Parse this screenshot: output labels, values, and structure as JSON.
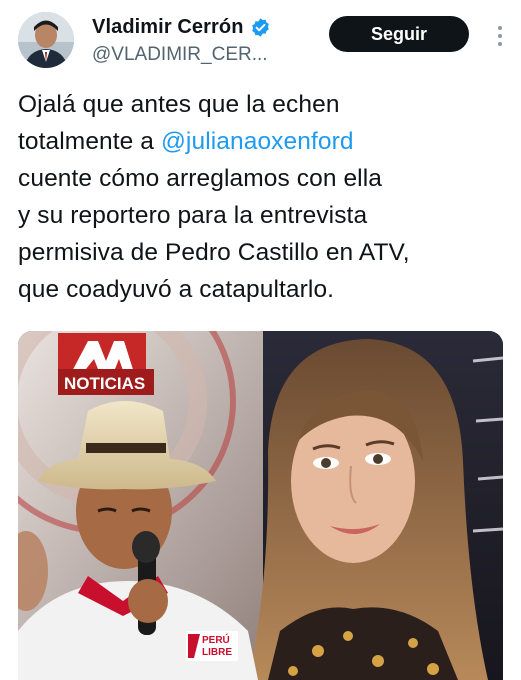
{
  "author": {
    "display_name": "Vladimir Cerrón",
    "handle": "@VLADIMIR_CER...",
    "verified": true
  },
  "actions": {
    "follow_label": "Seguir",
    "more_icon": "more-vertical-icon"
  },
  "tweet": {
    "lines": [
      {
        "text": "Ojalá que antes que la echen"
      },
      {
        "prefix": "totalmente a ",
        "mention": "@julianaoxenford"
      },
      {
        "text": "cuente cómo arreglamos con ella"
      },
      {
        "text": "y su reportero para la entrevista"
      },
      {
        "text": "permisiva de Pedro Castillo en ATV,"
      },
      {
        "text": "que coadyuvó a catapultarlo."
      }
    ]
  },
  "media": {
    "logo_text": "NOTICIAS",
    "logo_brand": "ATV",
    "shirt_badge": {
      "line1": "PERÚ",
      "line2": "LIBRE"
    }
  },
  "colors": {
    "accent": "#1d9bf0",
    "verified": "#1d9bf0",
    "follow_bg": "#0f1419",
    "text": "#0f1419",
    "secondary_text": "#536471",
    "atv_red": "#c62828"
  }
}
